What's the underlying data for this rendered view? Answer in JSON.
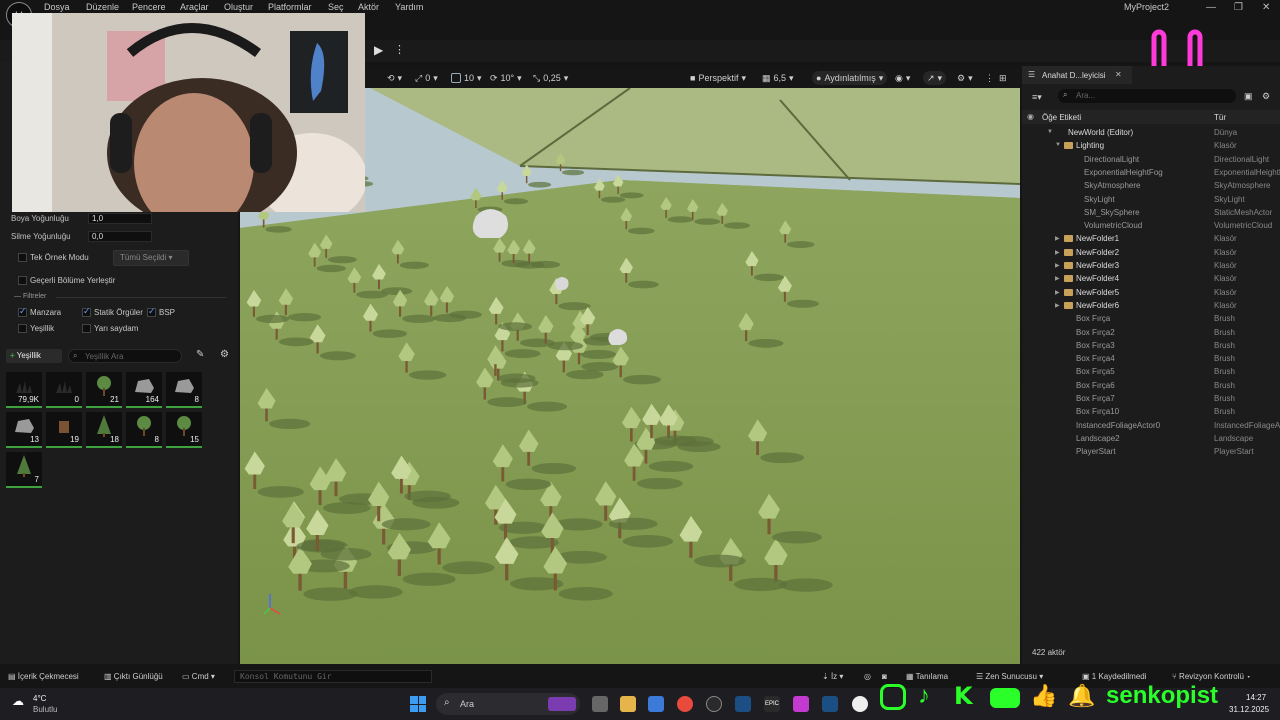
{
  "window": {
    "project_title": "MyProject2",
    "logo_glyph": "U",
    "controls": [
      "—",
      "❐",
      "✕"
    ]
  },
  "menu": [
    "Dosya",
    "Düzenle",
    "Pencere",
    "Araçlar",
    "Oluştur",
    "Platformlar",
    "Seç",
    "Aktör",
    "Yardım"
  ],
  "viewport_toolbar": {
    "rotate_snap": "0",
    "grid_snap": "10",
    "angle_snap": "10°",
    "scale_snap": "0,25",
    "view_mode": "Perspektif",
    "camera_speed": "6,5",
    "lighting_mode": "Aydınlatılmış"
  },
  "foliage_panel": {
    "paint_density_label": "Boya Yoğunluğu",
    "paint_density_value": "1,0",
    "erase_density_label": "Silme Yoğunluğu",
    "erase_density_value": "0,0",
    "single_instance_label": "Tek Örnek Modu",
    "single_instance_dropdown": "Tümü Seçildi",
    "place_in_level_label": "Geçerli Bölüme Yerleştir",
    "filters_label": "Filtreler",
    "filters": [
      {
        "label": "Manzara",
        "checked": true
      },
      {
        "label": "Statik Örgüler",
        "checked": true
      },
      {
        "label": "BSP",
        "checked": true
      },
      {
        "label": "Yeşillik",
        "checked": false
      },
      {
        "label": "Yarı saydam",
        "checked": false
      }
    ],
    "add_button": "Yeşillik",
    "search_placeholder": "Yeşillik Ara",
    "tiles": [
      {
        "count": "79,9K",
        "icon": "grass-icon"
      },
      {
        "count": "0",
        "icon": "grass-icon"
      },
      {
        "count": "21",
        "icon": "tree-icon"
      },
      {
        "count": "164",
        "icon": "rock-icon"
      },
      {
        "count": "8",
        "icon": "rock-icon"
      },
      {
        "count": "13",
        "icon": "rock-icon"
      },
      {
        "count": "19",
        "icon": "stump-icon"
      },
      {
        "count": "18",
        "icon": "pine-icon"
      },
      {
        "count": "8",
        "icon": "tree-icon"
      },
      {
        "count": "15",
        "icon": "tree-icon"
      },
      {
        "count": "7",
        "icon": "pine-icon"
      }
    ]
  },
  "outliner": {
    "tab_title": "Anahat D...leyicisi",
    "search_placeholder": "Ara...",
    "column_label": "Öğe Etiketi",
    "column_type": "Tür",
    "rows": [
      {
        "name": "NewWorld (Editor)",
        "type": "Dünya",
        "level": 0,
        "kind": "world"
      },
      {
        "name": "Lighting",
        "type": "Klasör",
        "level": 1,
        "kind": "folder-open"
      },
      {
        "name": "DirectionalLight",
        "type": "DirectionalLight",
        "level": 2,
        "kind": "actor"
      },
      {
        "name": "ExponentialHeightFog",
        "type": "ExponentialHeightFog",
        "level": 2,
        "kind": "actor"
      },
      {
        "name": "SkyAtmosphere",
        "type": "SkyAtmosphere",
        "level": 2,
        "kind": "actor"
      },
      {
        "name": "SkyLight",
        "type": "SkyLight",
        "level": 2,
        "kind": "actor"
      },
      {
        "name": "SM_SkySphere",
        "type": "StaticMeshActor",
        "level": 2,
        "kind": "actor"
      },
      {
        "name": "VolumetricCloud",
        "type": "VolumetricCloud",
        "level": 2,
        "kind": "actor"
      },
      {
        "name": "NewFolder1",
        "type": "Klasör",
        "level": 1,
        "kind": "folder"
      },
      {
        "name": "NewFolder2",
        "type": "Klasör",
        "level": 1,
        "kind": "folder"
      },
      {
        "name": "NewFolder3",
        "type": "Klasör",
        "level": 1,
        "kind": "folder"
      },
      {
        "name": "NewFolder4",
        "type": "Klasör",
        "level": 1,
        "kind": "folder"
      },
      {
        "name": "NewFolder5",
        "type": "Klasör",
        "level": 1,
        "kind": "folder"
      },
      {
        "name": "NewFolder6",
        "type": "Klasör",
        "level": 1,
        "kind": "folder"
      },
      {
        "name": "Box Fırça",
        "type": "Brush",
        "level": 1,
        "kind": "actor"
      },
      {
        "name": "Box Fırça2",
        "type": "Brush",
        "level": 1,
        "kind": "actor"
      },
      {
        "name": "Box Fırça3",
        "type": "Brush",
        "level": 1,
        "kind": "actor"
      },
      {
        "name": "Box Fırça4",
        "type": "Brush",
        "level": 1,
        "kind": "actor"
      },
      {
        "name": "Box Fırça5",
        "type": "Brush",
        "level": 1,
        "kind": "actor"
      },
      {
        "name": "Box Fırça6",
        "type": "Brush",
        "level": 1,
        "kind": "actor"
      },
      {
        "name": "Box Fırça7",
        "type": "Brush",
        "level": 1,
        "kind": "actor"
      },
      {
        "name": "Box Fırça10",
        "type": "Brush",
        "level": 1,
        "kind": "actor"
      },
      {
        "name": "InstancedFoliageActor0",
        "type": "InstancedFoliageActor",
        "level": 1,
        "kind": "actor"
      },
      {
        "name": "Landscape2",
        "type": "Landscape",
        "level": 1,
        "kind": "actor"
      },
      {
        "name": "PlayerStart",
        "type": "PlayerStart",
        "level": 1,
        "kind": "actor"
      }
    ],
    "actor_count": "422 aktör"
  },
  "bottom_bar": {
    "content_drawer": "İçerik Çekmecesi",
    "output_log": "Çıktı Günlüğü",
    "cmd": "Cmd",
    "console_placeholder": "Konsol Komutunu Gir",
    "trace": "İz",
    "diagnostics": "Tanılama",
    "zen_server": "Zen Sunucusu",
    "saved": "1 Kaydedilmedi",
    "revision": "Revizyon Kontrolü"
  },
  "taskbar": {
    "weather_temp": "4°C",
    "weather_desc": "Bulutlu",
    "search": "Ara",
    "time": "14:27",
    "date": "31.12.2025",
    "epic_label": "EPIC"
  },
  "overlay": {
    "channel_name": "senkopist",
    "brand_color": "#2aff2a",
    "smiley_color": "#ff3ad8"
  },
  "colors": {
    "accent": "#5aa0ff",
    "foliage_green": "#3ea33e",
    "folder": "#c9a05a"
  }
}
